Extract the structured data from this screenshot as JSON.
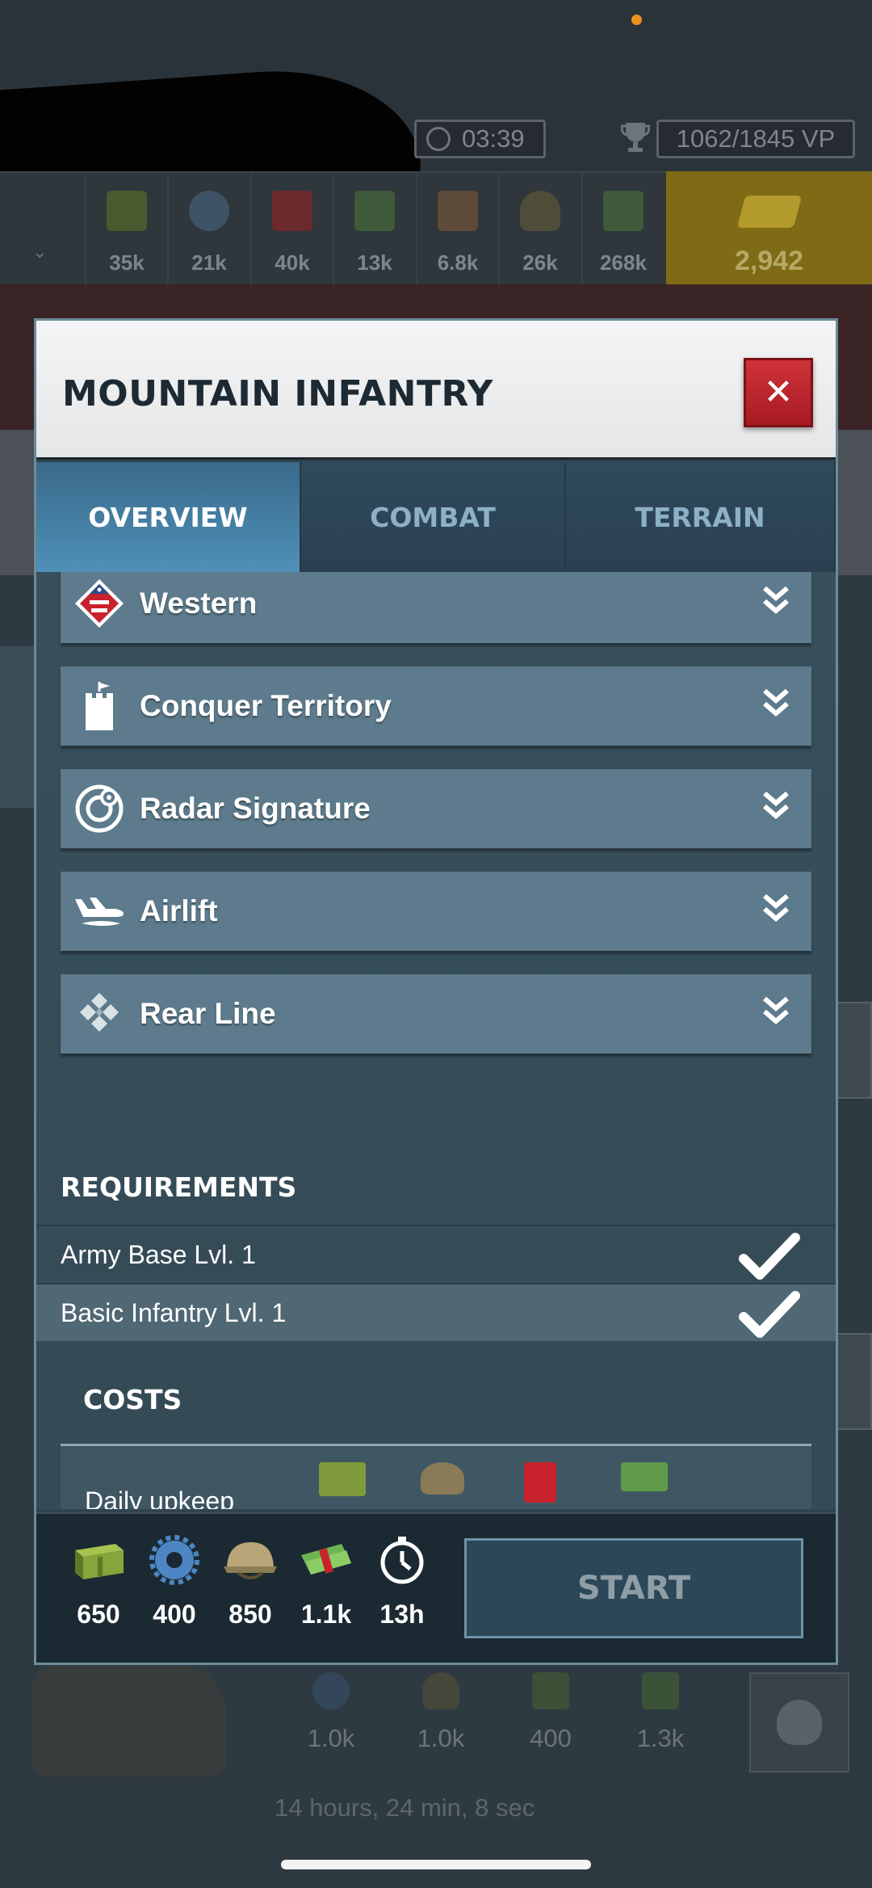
{
  "status_bar": {
    "indicator_color": "#e8921e"
  },
  "top_bar": {
    "timer": "03:39",
    "victory_points": "1062/1845 VP"
  },
  "resources": [
    {
      "icon": "supplies-crate-icon",
      "value": "35k"
    },
    {
      "icon": "components-gear-icon",
      "value": "21k"
    },
    {
      "icon": "fuel-can-icon",
      "value": "40k"
    },
    {
      "icon": "electronics-icon",
      "value": "13k"
    },
    {
      "icon": "rare-materials-icon",
      "value": "6.8k"
    },
    {
      "icon": "manpower-helmet-icon",
      "value": "26k"
    },
    {
      "icon": "money-icon",
      "value": "268k"
    }
  ],
  "gold": {
    "icon": "gold-bars-icon",
    "value": "2,942"
  },
  "modal": {
    "title": "MOUNTAIN INFANTRY",
    "tabs": [
      {
        "label": "OVERVIEW",
        "active": true
      },
      {
        "label": "COMBAT",
        "active": false
      },
      {
        "label": "TERRAIN",
        "active": false
      }
    ],
    "features": [
      {
        "label": "Western",
        "icon": "western-doctrine-shield-icon"
      },
      {
        "label": "Conquer Territory",
        "icon": "castle-tower-icon"
      },
      {
        "label": "Radar Signature",
        "icon": "radar-icon"
      },
      {
        "label": "Airlift",
        "icon": "airlift-plane-icon"
      },
      {
        "label": "Rear Line",
        "icon": "rear-line-diamond-icon"
      }
    ],
    "requirements": {
      "title": "REQUIREMENTS",
      "items": [
        {
          "label": "Army Base Lvl. 1",
          "met": true
        },
        {
          "label": "Basic Infantry Lvl. 1",
          "met": true
        }
      ]
    },
    "costs": {
      "title": "COSTS",
      "row_label": "Daily upkeep"
    },
    "footer": {
      "costs": [
        {
          "icon": "supplies-crate-icon",
          "value": "650"
        },
        {
          "icon": "components-gear-icon",
          "value": "400"
        },
        {
          "icon": "manpower-helmet-icon",
          "value": "850"
        },
        {
          "icon": "money-icon",
          "value": "1.1k"
        },
        {
          "icon": "build-time-stopwatch-icon",
          "value": "13h"
        }
      ],
      "start_label": "START"
    }
  },
  "background": {
    "unit_costs": [
      {
        "icon": "components-gear-icon",
        "value": "1.0k"
      },
      {
        "icon": "manpower-helmet-icon",
        "value": "1.0k"
      },
      {
        "icon": "electronics-icon",
        "value": "400"
      },
      {
        "icon": "money-icon",
        "value": "1.3k"
      }
    ],
    "timer_text": "14 hours, 24 min, 8 sec"
  },
  "colors": {
    "accent_blue": "#4f90b9",
    "close_red": "#c3262e",
    "gold": "#7f6b16",
    "panel": "#5d7b8c"
  }
}
